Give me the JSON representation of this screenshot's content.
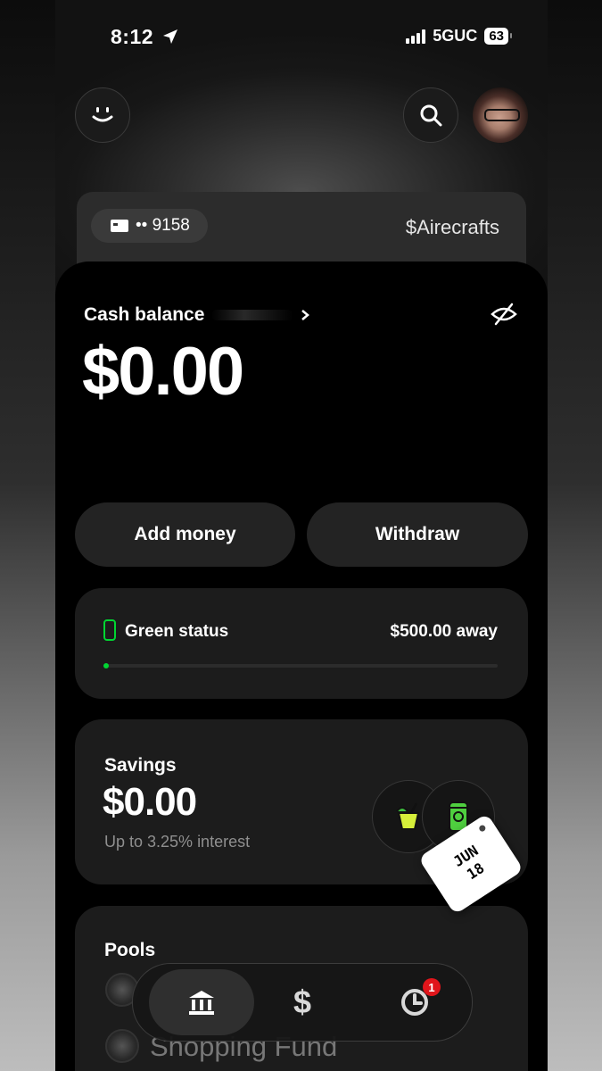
{
  "status_bar": {
    "time": "8:12",
    "network": "5GUC",
    "battery": "63"
  },
  "header": {
    "left_icon": "smiley-icon",
    "search_icon": "search-icon"
  },
  "card": {
    "last_digits": "•• 9158",
    "cashtag": "$Airecrafts"
  },
  "balance": {
    "label": "Cash balance",
    "amount": "$0.00"
  },
  "actions": {
    "add_money": "Add money",
    "withdraw": "Withdraw"
  },
  "green_status": {
    "label": "Green status",
    "away": "$500.00 away",
    "progress": 0.01,
    "color": "#00d632"
  },
  "savings": {
    "title": "Savings",
    "amount": "$0.00",
    "subtitle": "Up to 3.25% interest"
  },
  "pools": {
    "title": "Pools",
    "items": [
      {
        "name": "Shopping Fund"
      }
    ]
  },
  "sticker": {
    "month": "JUN",
    "day": "18"
  },
  "tabs": {
    "active": "banking",
    "items": [
      "bank-icon",
      "dollar-icon",
      "clock-icon"
    ],
    "dollar_label": "$",
    "activity_badge": "1"
  }
}
